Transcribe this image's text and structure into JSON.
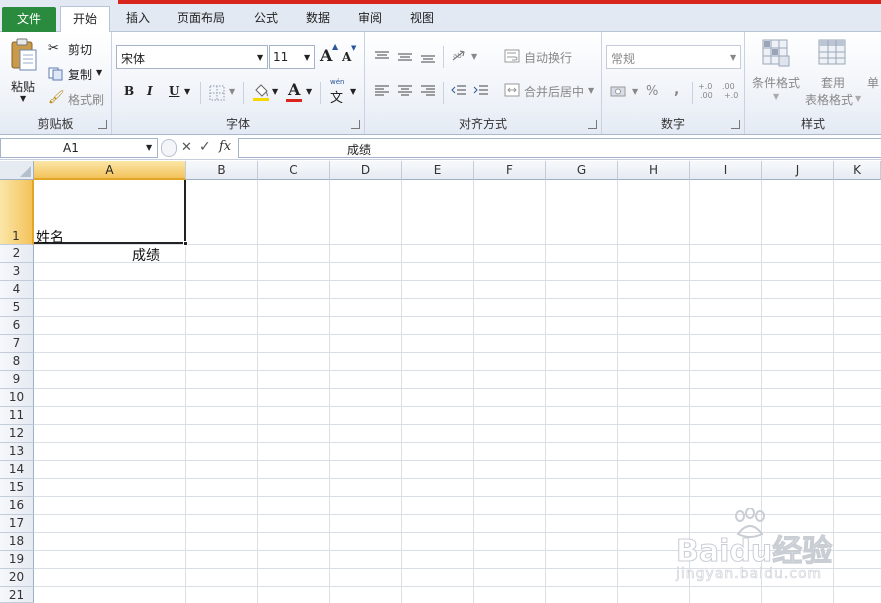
{
  "tabs": [
    {
      "label": "文件",
      "active": false,
      "color": "#2a8a3e"
    },
    {
      "label": "开始",
      "active": true
    },
    {
      "label": "插入"
    },
    {
      "label": "页面布局"
    },
    {
      "label": "公式"
    },
    {
      "label": "数据"
    },
    {
      "label": "审阅"
    },
    {
      "label": "视图"
    }
  ],
  "clipboard": {
    "paste": "粘贴",
    "cut": "剪切",
    "copy": "复制",
    "format_painter": "格式刷",
    "label": "剪贴板"
  },
  "font": {
    "name": "宋体",
    "size": "11",
    "bold": "B",
    "italic": "I",
    "underline": "U",
    "grow": "A",
    "shrink": "A",
    "font_color": "A",
    "phonetic": "文",
    "phonetic_top": "wén",
    "label": "字体",
    "font_color_hex": "#d9261c"
  },
  "alignment": {
    "wrap_text": "自动换行",
    "merge_center": "合并后居中",
    "label": "对齐方式"
  },
  "number": {
    "format": "常规",
    "percent": "%",
    "comma": ",",
    "inc_decimal_top": "+.0",
    "inc_decimal_bottom": ".00",
    "dec_decimal_top": ".00",
    "dec_decimal_bottom": "+.0",
    "label": "数字"
  },
  "styles": {
    "conditional": "条件格式",
    "table_format_1": "套用",
    "table_format_2": "表格格式",
    "cell_styles": "单",
    "label": "样式"
  },
  "formula_bar": {
    "name_box": "A1",
    "cancel": "✕",
    "enter": "✓",
    "fx": "fx",
    "value": "成绩"
  },
  "sheet": {
    "columns": [
      "A",
      "B",
      "C",
      "D",
      "E",
      "F",
      "G",
      "H",
      "I",
      "J",
      "K"
    ],
    "rows": [
      "1",
      "2",
      "3",
      "4",
      "5",
      "6",
      "7",
      "8",
      "9",
      "10",
      "11",
      "12",
      "13",
      "14",
      "15",
      "16",
      "17",
      "18",
      "19",
      "20",
      "21"
    ],
    "selected_cell": "A1",
    "cells": {
      "A1": "姓名",
      "A2": "成绩"
    }
  },
  "watermark": {
    "brand": "Baidu经验",
    "url": "jingyan.baidu.com"
  }
}
